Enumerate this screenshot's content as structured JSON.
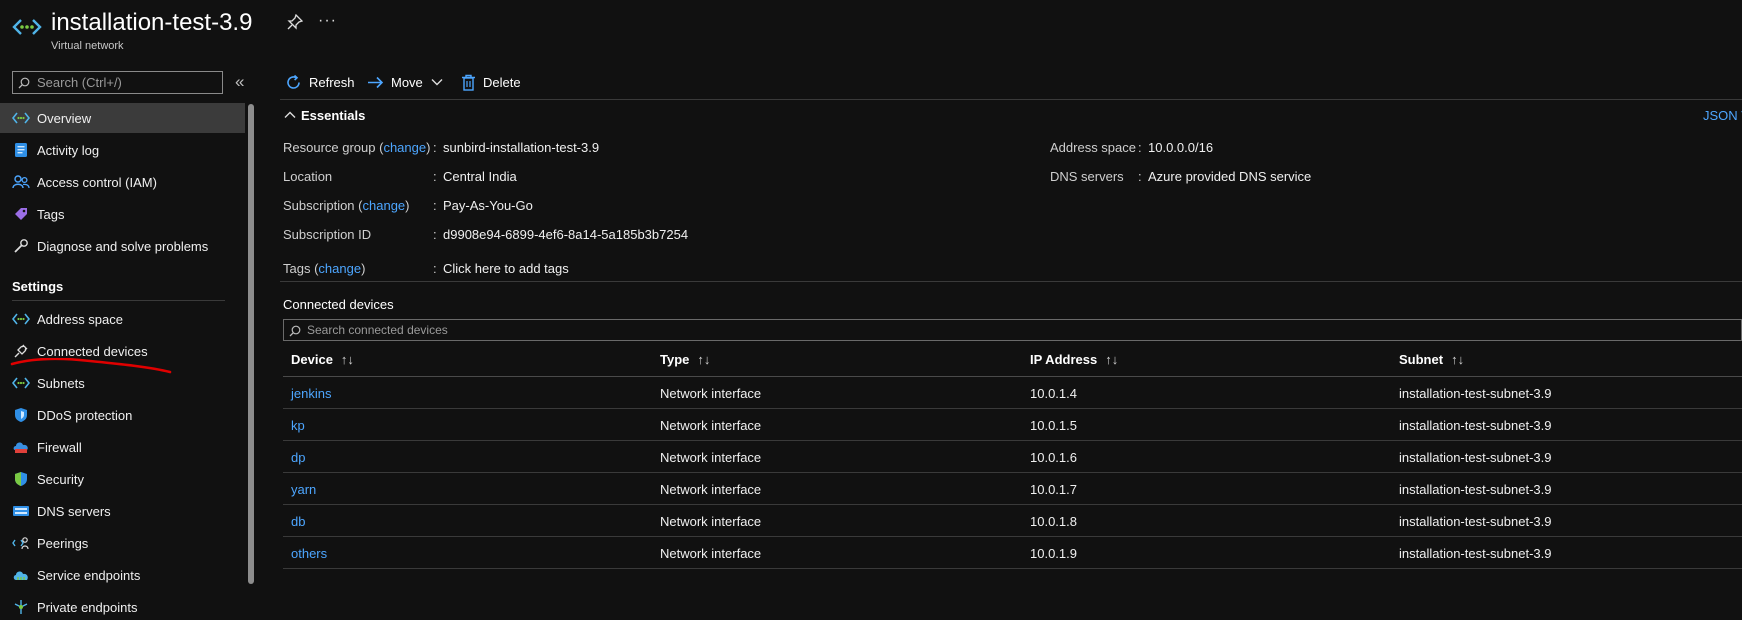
{
  "header": {
    "title": "installation-test-3.9",
    "subtitle": "Virtual network",
    "logo_icon": "virtual-network-icon",
    "more_label": "···"
  },
  "sidebar": {
    "search_placeholder": "Search (Ctrl+/)",
    "collapse_label": "«",
    "items": [
      {
        "label": "Overview",
        "icon": "virtual-network-icon",
        "active": true
      },
      {
        "label": "Activity log",
        "icon": "activity-log-icon"
      },
      {
        "label": "Access control (IAM)",
        "icon": "people-icon"
      },
      {
        "label": "Tags",
        "icon": "tag-icon"
      },
      {
        "label": "Diagnose and solve problems",
        "icon": "wrench-icon"
      }
    ],
    "settings_heading": "Settings",
    "settings_items": [
      {
        "label": "Address space",
        "icon": "virtual-network-icon"
      },
      {
        "label": "Connected devices",
        "icon": "plug-icon"
      },
      {
        "label": "Subnets",
        "icon": "virtual-network-icon"
      },
      {
        "label": "DDoS protection",
        "icon": "shield-icon"
      },
      {
        "label": "Firewall",
        "icon": "firewall-icon"
      },
      {
        "label": "Security",
        "icon": "shield-icon"
      },
      {
        "label": "DNS servers",
        "icon": "dns-server-icon"
      },
      {
        "label": "Peerings",
        "icon": "peerings-icon"
      },
      {
        "label": "Service endpoints",
        "icon": "cloud-icon"
      },
      {
        "label": "Private endpoints",
        "icon": "private-endpoint-icon"
      }
    ]
  },
  "toolbar": {
    "refresh_label": "Refresh",
    "move_label": "Move",
    "delete_label": "Delete"
  },
  "essentials": {
    "title": "Essentials",
    "json_view_label": "JSON View",
    "change_label": "change",
    "resource_group_label": "Resource group",
    "resource_group_value": "sunbird-installation-test-3.9",
    "location_label": "Location",
    "location_value": "Central India",
    "subscription_label": "Subscription",
    "subscription_value": "Pay-As-You-Go",
    "subscription_id_label": "Subscription ID",
    "subscription_id_value": "d9908e94-6899-4ef6-8a14-5a185b3b7254",
    "tags_label": "Tags",
    "tags_value": "Click here to add tags",
    "address_space_label": "Address space",
    "address_space_value": "10.0.0.0/16",
    "dns_servers_label": "DNS servers",
    "dns_servers_value": "Azure provided DNS service"
  },
  "connected_devices": {
    "title": "Connected devices",
    "search_placeholder": "Search connected devices",
    "columns": [
      "Device",
      "Type",
      "IP Address",
      "Subnet"
    ],
    "sort_glyph": "↑↓",
    "rows": [
      {
        "device": "jenkins",
        "type": "Network interface",
        "ip": "10.0.1.4",
        "subnet": "installation-test-subnet-3.9"
      },
      {
        "device": "kp",
        "type": "Network interface",
        "ip": "10.0.1.5",
        "subnet": "installation-test-subnet-3.9"
      },
      {
        "device": "dp",
        "type": "Network interface",
        "ip": "10.0.1.6",
        "subnet": "installation-test-subnet-3.9"
      },
      {
        "device": "yarn",
        "type": "Network interface",
        "ip": "10.0.1.7",
        "subnet": "installation-test-subnet-3.9"
      },
      {
        "device": "db",
        "type": "Network interface",
        "ip": "10.0.1.8",
        "subnet": "installation-test-subnet-3.9"
      },
      {
        "device": "others",
        "type": "Network interface",
        "ip": "10.0.1.9",
        "subnet": "installation-test-subnet-3.9"
      }
    ]
  },
  "colors": {
    "background": "#111111",
    "link": "#4da6ff",
    "accent": "#1e90ff",
    "annotation": "#e00000"
  }
}
